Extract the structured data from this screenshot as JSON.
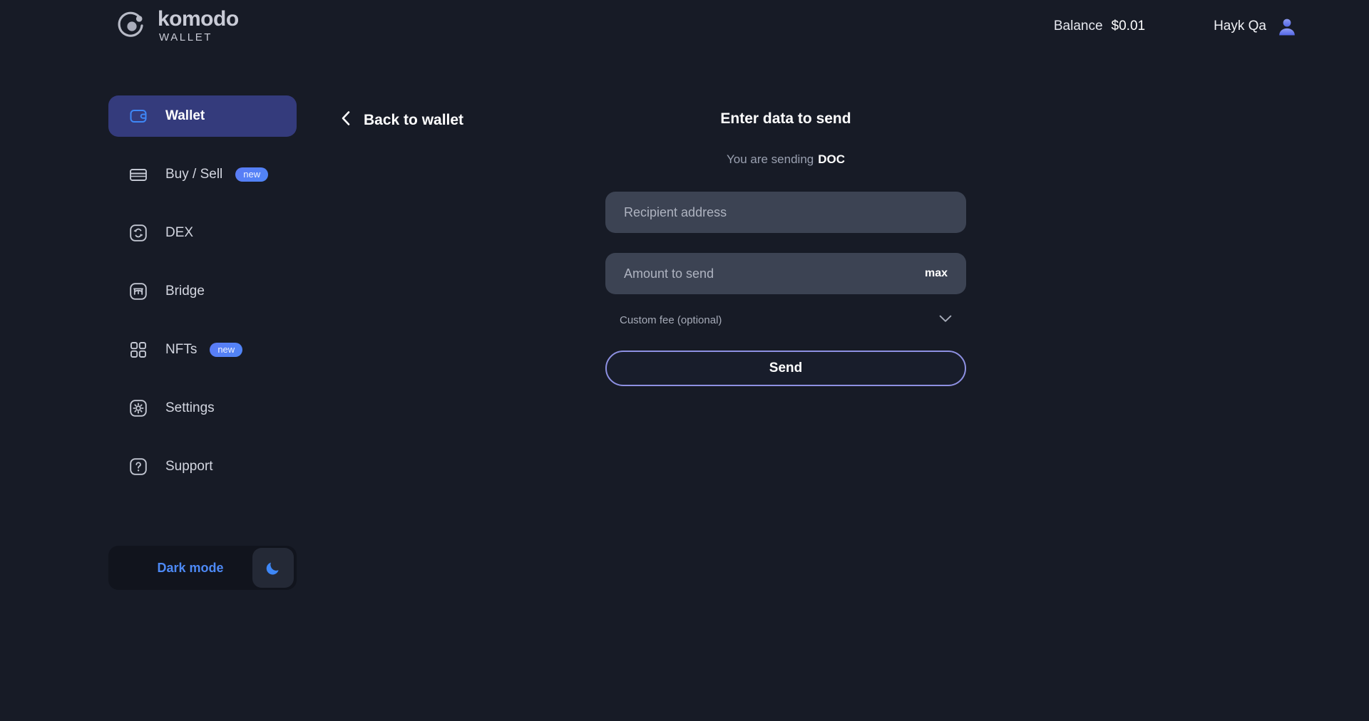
{
  "brand": {
    "name": "komodo",
    "subtitle": "WALLET",
    "logo_icon": "komodo-logo-icon"
  },
  "header": {
    "balance_label": "Balance",
    "balance_value": "$0.01",
    "user_name": "Hayk Qa",
    "avatar_icon": "user-avatar-icon"
  },
  "sidebar": {
    "items": [
      {
        "label": "Wallet",
        "icon": "wallet-icon",
        "active": true,
        "badge": null
      },
      {
        "label": "Buy / Sell",
        "icon": "card-icon",
        "active": false,
        "badge": "new"
      },
      {
        "label": "DEX",
        "icon": "swap-icon",
        "active": false,
        "badge": null
      },
      {
        "label": "Bridge",
        "icon": "bridge-icon",
        "active": false,
        "badge": null
      },
      {
        "label": "NFTs",
        "icon": "grid-icon",
        "active": false,
        "badge": "new"
      },
      {
        "label": "Settings",
        "icon": "gear-icon",
        "active": false,
        "badge": null
      },
      {
        "label": "Support",
        "icon": "question-icon",
        "active": false,
        "badge": null
      }
    ],
    "dark_mode": {
      "label": "Dark mode",
      "icon": "moon-icon",
      "enabled": true
    }
  },
  "main": {
    "back_link": {
      "label": "Back to wallet",
      "icon": "chevron-left-icon"
    },
    "title": "Enter data to send",
    "subtitle_prefix": "You are sending",
    "subtitle_coin": "DOC",
    "recipient_field": {
      "placeholder": "Recipient address",
      "value": ""
    },
    "amount_field": {
      "placeholder": "Amount to send",
      "value": "",
      "max_label": "max"
    },
    "custom_fee": {
      "label": "Custom fee (optional)",
      "icon": "chevron-down-icon",
      "expanded": false
    },
    "send_button": {
      "label": "Send"
    }
  },
  "colors": {
    "page_background": "#171b26",
    "sidebar_active": "#343b7c",
    "accent_blue": "#4d89f5",
    "badge_blue": "#5b7bf5",
    "input_background": "#3c4353",
    "send_border": "#8d90e2"
  }
}
